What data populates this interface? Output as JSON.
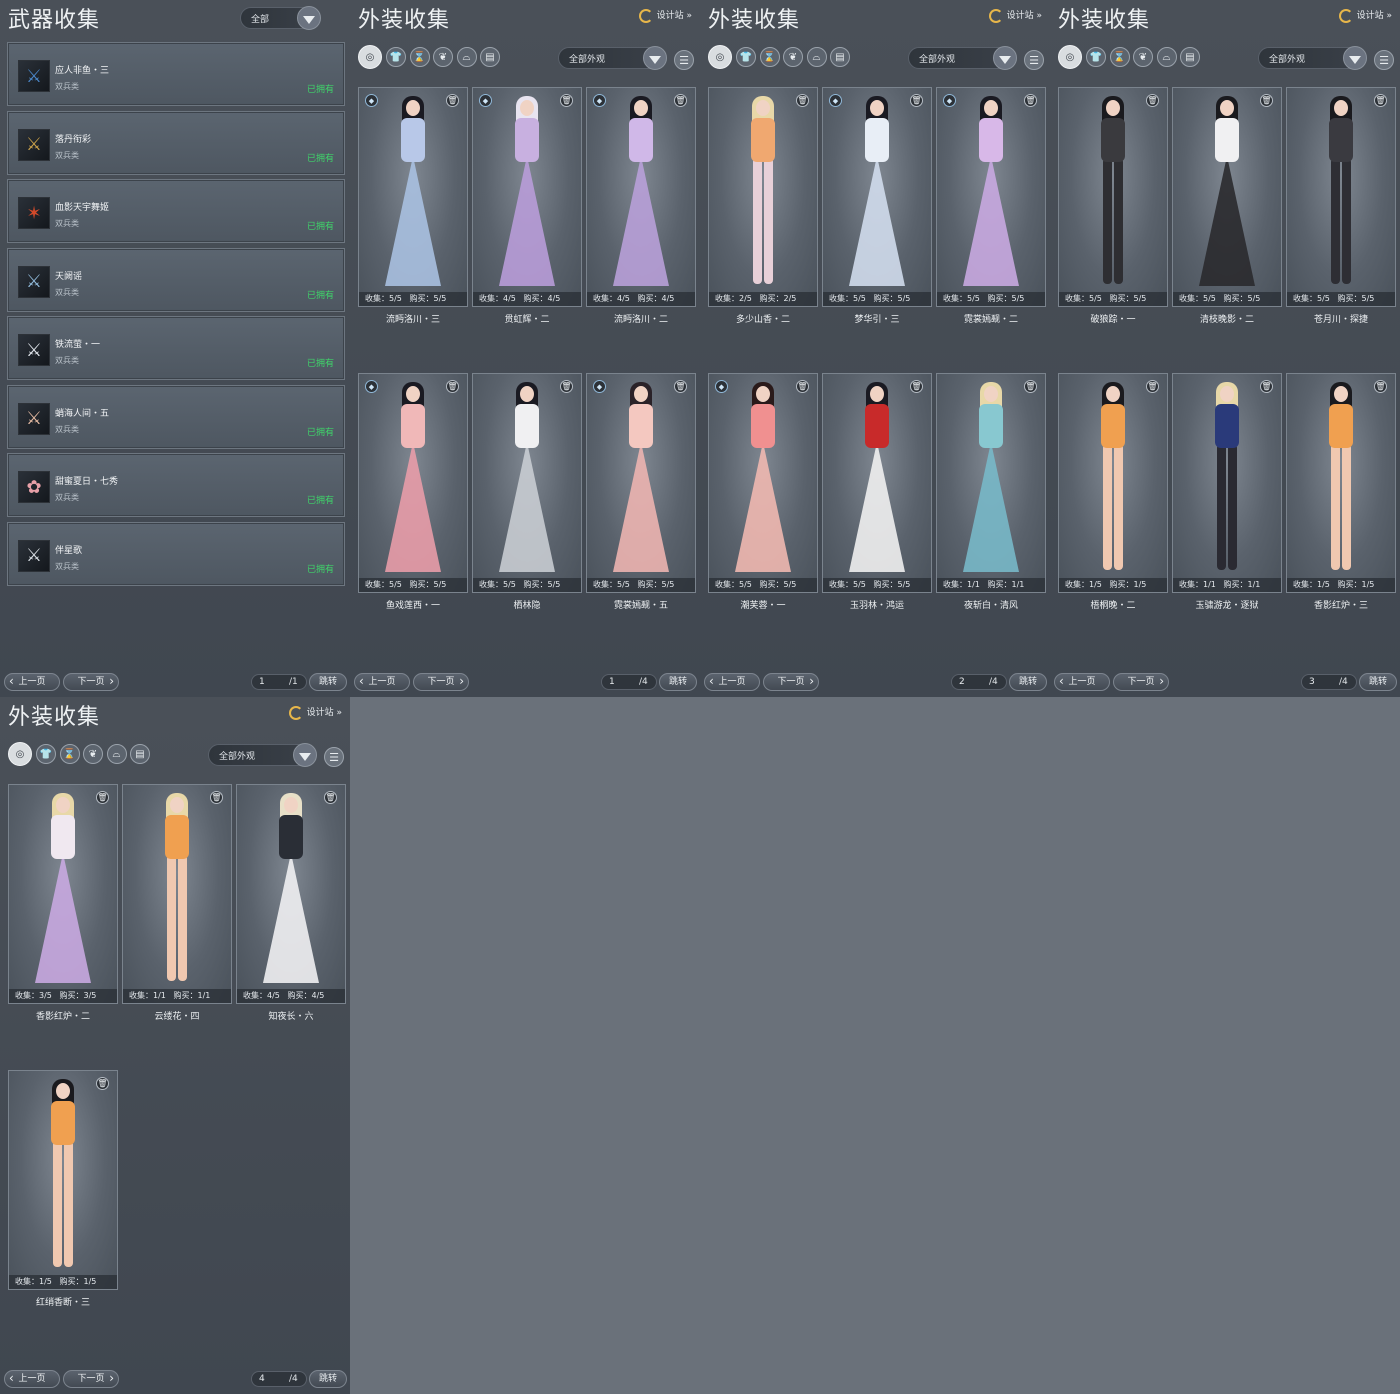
{
  "weapon_panel": {
    "title": "武器收集",
    "filter": "全部",
    "items": [
      {
        "name": "应人非鱼・三",
        "type": "双兵类",
        "status": "已拥有",
        "icon": "dual-swords-icon",
        "glyph": "⚔",
        "color": "#4a86c8"
      },
      {
        "name": "落丹衔彩",
        "type": "双兵类",
        "status": "已拥有",
        "icon": "dual-swords-icon",
        "glyph": "⚔",
        "color": "#c8a04a"
      },
      {
        "name": "血影天宇舞姬",
        "type": "双兵类",
        "status": "已拥有",
        "icon": "fan-weapon-icon",
        "glyph": "✶",
        "color": "#d24a2a"
      },
      {
        "name": "天阙谣",
        "type": "双兵类",
        "status": "已拥有",
        "icon": "dual-swords-icon",
        "glyph": "⚔",
        "color": "#8fb8d8"
      },
      {
        "name": "铁流萤・一",
        "type": "双兵类",
        "status": "已拥有",
        "icon": "dual-swords-icon",
        "glyph": "⚔",
        "color": "#dfe4ea"
      },
      {
        "name": "蛸海人间・五",
        "type": "双兵类",
        "status": "已拥有",
        "icon": "dual-swords-icon",
        "glyph": "⚔",
        "color": "#e2b8a0"
      },
      {
        "name": "甜蜜夏日・七秀",
        "type": "双兵类",
        "status": "已拥有",
        "icon": "flower-weapon-icon",
        "glyph": "✿",
        "color": "#e8a0a8"
      },
      {
        "name": "伴星歌",
        "type": "双兵类",
        "status": "已拥有",
        "icon": "dual-swords-icon",
        "glyph": "⚔",
        "color": "#d8dde2"
      }
    ],
    "pager": {
      "prev": "上一页",
      "next": "下一页",
      "current": "1",
      "total": "/1",
      "jump": "跳转"
    }
  },
  "outfit_common": {
    "title": "外装收集",
    "designer": "设计站",
    "filter": "全部外观",
    "collect_label": "收集：",
    "buy_label": "购买：",
    "prev": "上一页",
    "next": "下一页",
    "jump": "跳转",
    "categories": [
      "all-icon",
      "top-icon",
      "waist-icon",
      "hair-icon",
      "hat-icon",
      "scroll-icon"
    ]
  },
  "outfit_pages": [
    {
      "page": "1",
      "total": "/4",
      "cards": [
        {
          "name": "流眄洛川・三",
          "collect": "5/5",
          "buy": "5/5",
          "gem": true,
          "hair": "#1a1a22",
          "top": "#b8c8e8",
          "bottom": "#a8c0e0",
          "dress": true
        },
        {
          "name": "贯虹辉・二",
          "collect": "4/5",
          "buy": "4/5",
          "gem": true,
          "hair": "#e8e4f0",
          "top": "#c8b0e0",
          "bottom": "#b89cd8",
          "dress": true
        },
        {
          "name": "流眄洛川・二",
          "collect": "4/5",
          "buy": "4/5",
          "gem": true,
          "hair": "#1a1a22",
          "top": "#d0b8e8",
          "bottom": "#b8a0d8",
          "dress": true
        },
        {
          "name": "鱼戏莲西・一",
          "collect": "5/5",
          "buy": "5/5",
          "gem": true,
          "hair": "#1a1a22",
          "top": "#f0b8b8",
          "bottom": "#e89ca8",
          "dress": true
        },
        {
          "name": "栖林隐",
          "collect": "5/5",
          "buy": "5/5",
          "gem": false,
          "hair": "#1a1a22",
          "top": "#f0f0f2",
          "bottom": "#c8ccd2",
          "dress": true
        },
        {
          "name": "霓裳嫣觋・五",
          "collect": "5/5",
          "buy": "5/5",
          "gem": true,
          "hair": "#2a2228",
          "top": "#f4c8c0",
          "bottom": "#ecb4b0",
          "dress": true
        }
      ]
    },
    {
      "page": "2",
      "total": "/4",
      "cards": [
        {
          "name": "多少山香・二",
          "collect": "2/5",
          "buy": "2/5",
          "gem": false,
          "hair": "#e8d8a8",
          "top": "#f0a870",
          "bottom": "#e8d0d8",
          "dress": false
        },
        {
          "name": "梦华引・三",
          "collect": "5/5",
          "buy": "5/5",
          "gem": true,
          "hair": "#1a1a22",
          "top": "#e8eef6",
          "bottom": "#d0dcec",
          "dress": true
        },
        {
          "name": "霓裳嫣觋・二",
          "collect": "5/5",
          "buy": "5/5",
          "gem": true,
          "hair": "#1a1a22",
          "top": "#d8b8e8",
          "bottom": "#c8a8e0",
          "dress": true
        },
        {
          "name": "潮芙蓉・一",
          "collect": "5/5",
          "buy": "5/5",
          "gem": true,
          "hair": "#2a1a1a",
          "top": "#f09090",
          "bottom": "#f0b8b0",
          "dress": true
        },
        {
          "name": "玉羽林・鸿运",
          "collect": "5/5",
          "buy": "5/5",
          "gem": false,
          "hair": "#1a1a22",
          "top": "#c82a2a",
          "bottom": "#f0f0f0",
          "dress": true
        },
        {
          "name": "夜斩白・清风",
          "collect": "1/1",
          "buy": "1/1",
          "gem": false,
          "hair": "#e8d8a8",
          "top": "#88c8d0",
          "bottom": "#78b8c8",
          "dress": true
        }
      ]
    },
    {
      "page": "3",
      "total": "/4",
      "cards": [
        {
          "name": "破狼踪・一",
          "collect": "5/5",
          "buy": "5/5",
          "gem": false,
          "hair": "#1a1a1e",
          "top": "#3a3a3e",
          "bottom": "#2e2e32",
          "dress": false
        },
        {
          "name": "清枝晚影・二",
          "collect": "5/5",
          "buy": "5/5",
          "gem": false,
          "hair": "#1a1a1e",
          "top": "#f0f0f2",
          "bottom": "#2a2a2e",
          "dress": true
        },
        {
          "name": "苍月川・探捷",
          "collect": "5/5",
          "buy": "5/5",
          "gem": false,
          "hair": "#1a1a1e",
          "top": "#3a3a40",
          "bottom": "#2e2e34",
          "dress": false
        },
        {
          "name": "梧桐晚・二",
          "collect": "1/5",
          "buy": "1/5",
          "gem": false,
          "hair": "#1a1a1e",
          "top": "#f0a050",
          "bottom": "#f0c8b0",
          "dress": false
        },
        {
          "name": "玉骕游龙・逐狱",
          "collect": "1/1",
          "buy": "1/1",
          "gem": false,
          "hair": "#e8d8a8",
          "top": "#2a3a7a",
          "bottom": "#2a2a32",
          "dress": false
        },
        {
          "name": "香影红炉・三",
          "collect": "1/5",
          "buy": "1/5",
          "gem": false,
          "hair": "#1a1a1e",
          "top": "#f0a050",
          "bottom": "#f0c8b0",
          "dress": false
        }
      ]
    },
    {
      "page": "4",
      "total": "/4",
      "cards": [
        {
          "name": "香影红炉・二",
          "collect": "3/5",
          "buy": "3/5",
          "gem": false,
          "hair": "#e8d8a8",
          "top": "#f0e8f0",
          "bottom": "#c8a8e0",
          "dress": true
        },
        {
          "name": "云缕花・四",
          "collect": "1/1",
          "buy": "1/1",
          "gem": false,
          "hair": "#e8d8a8",
          "top": "#f0a050",
          "bottom": "#f0c8b0",
          "dress": false
        },
        {
          "name": "知夜长・六",
          "collect": "4/5",
          "buy": "4/5",
          "gem": false,
          "hair": "#e8e0c8",
          "top": "#2a2e36",
          "bottom": "#f0f0f2",
          "dress": true
        },
        {
          "name": "红绡香断・三",
          "collect": "1/5",
          "buy": "1/5",
          "gem": false,
          "hair": "#1a1a1e",
          "top": "#f0a050",
          "bottom": "#f0c8b0",
          "dress": false
        }
      ]
    }
  ]
}
